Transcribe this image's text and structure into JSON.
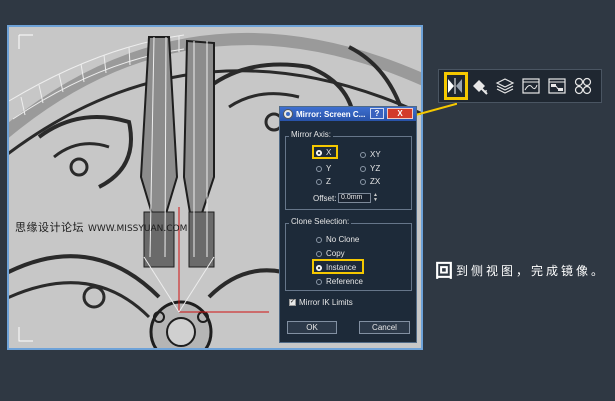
{
  "dialog": {
    "title": "Mirror: Screen C...",
    "help_label": "?",
    "close_label": "X",
    "mirror_axis": {
      "label": "Mirror Axis:",
      "options": [
        "X",
        "Y",
        "Z",
        "XY",
        "YZ",
        "ZX"
      ],
      "selected": "X",
      "offset_label": "Offset:",
      "offset_value": "0.0mm"
    },
    "clone_selection": {
      "label": "Clone Selection:",
      "options": [
        "No Clone",
        "Copy",
        "Instance",
        "Reference"
      ],
      "selected": "Instance"
    },
    "mirror_ik": {
      "label": "Mirror IK Limits",
      "checked": true
    },
    "ok_label": "OK",
    "cancel_label": "Cancel"
  },
  "toolbar": {
    "icons": [
      "mirror-icon",
      "align-icon",
      "layers-icon",
      "curve-editor-icon",
      "schematic-view-icon",
      "material-editor-icon"
    ],
    "highlighted": "mirror-icon"
  },
  "watermark": {
    "site_name": "思缘设计论坛",
    "url": "WWW.MISSYUAN.COM"
  },
  "instruction": {
    "lead_char": "回",
    "text": "到侧视图，完成镜像。"
  },
  "colors": {
    "highlight": "#f5c800",
    "viewport_border": "#6ea2d8",
    "titlebar": "#3e6fd0",
    "close_button": "#d33b2a",
    "background": "#2f3843"
  }
}
